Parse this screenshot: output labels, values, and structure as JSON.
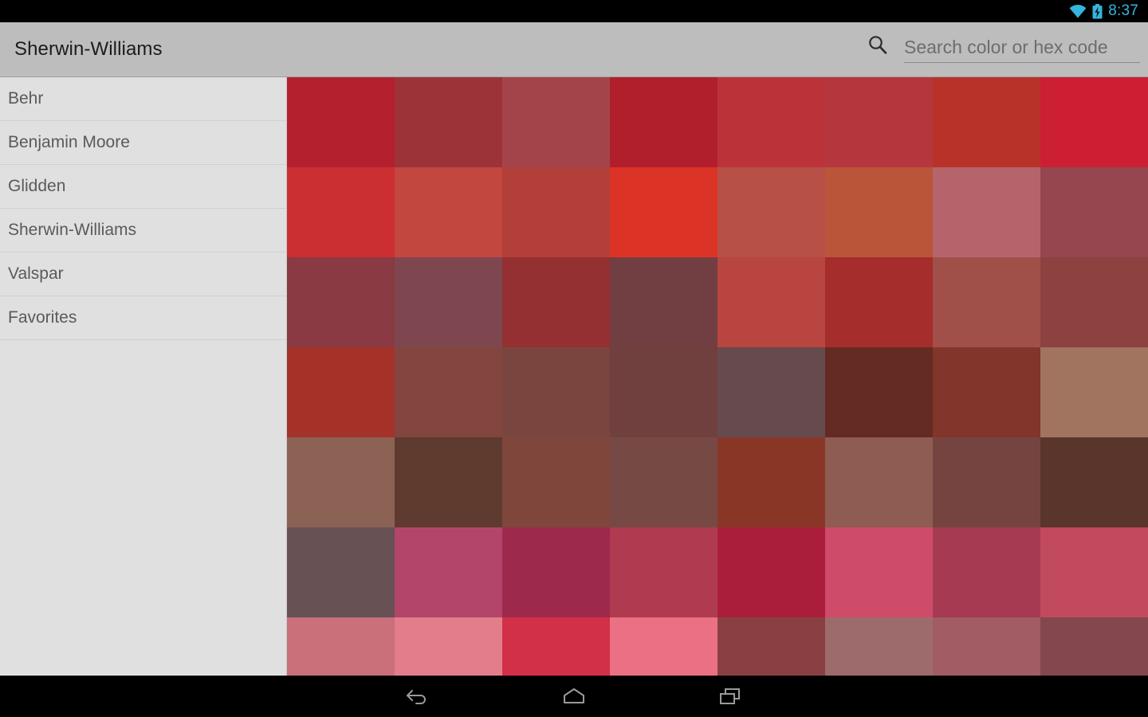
{
  "status_bar": {
    "time": "8:37",
    "time_color": "#35b4dd",
    "icons": [
      "wifi-icon",
      "battery-charging-icon"
    ]
  },
  "app_bar": {
    "title": "Sherwin-Williams",
    "background": "#bdbdbd",
    "search": {
      "icon": "search-icon",
      "placeholder": "Search color or hex code",
      "value": ""
    }
  },
  "sidebar": {
    "background": "#e0e0e0",
    "items": [
      {
        "label": "Behr"
      },
      {
        "label": "Benjamin Moore"
      },
      {
        "label": "Glidden"
      },
      {
        "label": "Sherwin-Williams"
      },
      {
        "label": "Valspar"
      },
      {
        "label": "Favorites"
      }
    ]
  },
  "color_grid": {
    "columns": 8,
    "rows": [
      [
        "#b5202f",
        "#9b3338",
        "#a3444a",
        "#b01f2b",
        "#bb3338",
        "#b5373d",
        "#b93229",
        "#cc1f33"
      ],
      [
        "#cb2f31",
        "#c2473f",
        "#b23f3a",
        "#dc3327",
        "#b75046",
        "#ba5539",
        "#b5646c",
        "#95464f"
      ],
      [
        "#893a42",
        "#7e4750",
        "#943031",
        "#713e41",
        "#b94540",
        "#a52d2b",
        "#a05049",
        "#8d4240"
      ],
      [
        "#a53229",
        "#82463f",
        "#7a453f",
        "#70403e",
        "#654b4e",
        "#642b22",
        "#81352b",
        "#a0745f"
      ],
      [
        "#8c6255",
        "#5f3a2e",
        "#7f463c",
        "#774944",
        "#8a3626",
        "#8f5c52",
        "#764440",
        "#5a352c"
      ],
      [
        "#675155",
        "#b4456a",
        "#9d2a4c",
        "#b03b50",
        "#ab1e3b",
        "#cf4b6a",
        "#a63a52",
        "#c14a5f"
      ],
      [
        "#c9707a",
        "#e27e8b",
        "#d23048",
        "#ec7083",
        "#8a4042",
        "#9e6b6c",
        "#a25c63",
        "#83474d"
      ]
    ]
  },
  "nav_bar": {
    "buttons": [
      {
        "name": "back-icon"
      },
      {
        "name": "home-icon"
      },
      {
        "name": "recents-icon"
      }
    ]
  }
}
